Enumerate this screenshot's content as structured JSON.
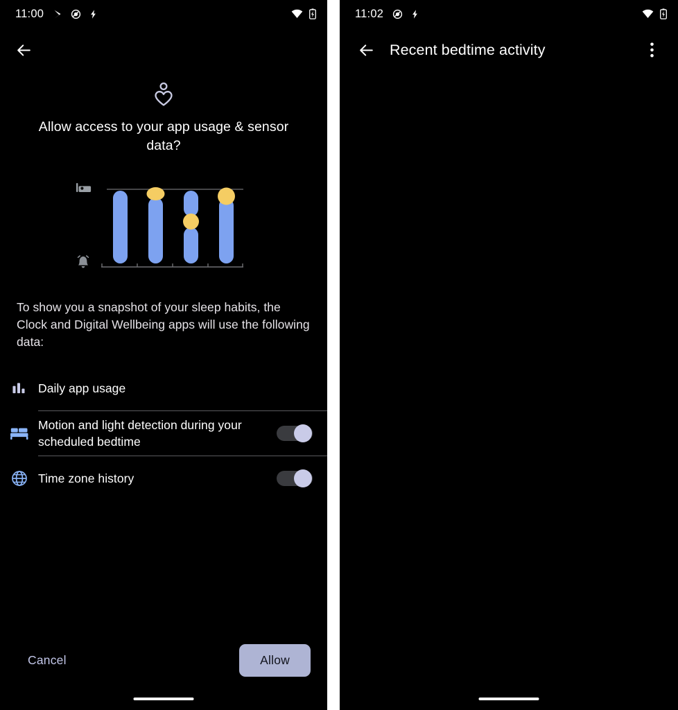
{
  "colors": {
    "background": "#000000",
    "gap": "#ffffff",
    "bar_blue": "#7da2f0",
    "dot_yellow": "#f5cd63",
    "accent_lavender": "#c2c6e8",
    "button_fill": "#aeb4d4",
    "button_text": "#11131c",
    "divider": "#5b5b5f",
    "switch_track": "#3a3b3f",
    "switch_thumb": "#c9cbe8",
    "list_icon_blue": "#8ab4f8",
    "chart_axis": "#6f6f73",
    "illus_icon_gray": "#9aa0a6"
  },
  "left_screen": {
    "status_bar": {
      "time": "11:00",
      "left_icons": [
        "play-store-icon",
        "do-not-disturb-icon",
        "flash-icon"
      ],
      "right_icons": [
        "wifi-icon",
        "battery-charging-icon"
      ]
    },
    "app_bar": {
      "back_icon": "arrow-back-icon"
    },
    "hero_icon": "person-heart-icon",
    "dialog_title": "Allow access to your app usage & sensor data?",
    "illustration": {
      "top_icon": "bed-icon",
      "bottom_icon": "alarm-bell-icon"
    },
    "body_text": "To show you a snapshot of your sleep habits, the Clock and Digital Wellbeing apps will use the following data:",
    "permissions": [
      {
        "icon": "bar-chart-icon",
        "label": "Daily app usage",
        "has_switch": false
      },
      {
        "icon": "bed-icon",
        "label": "Motion and light detection during your scheduled bedtime",
        "has_switch": true,
        "switch_on": true
      },
      {
        "icon": "globe-icon",
        "label": "Time zone history",
        "has_switch": true,
        "switch_on": true
      }
    ],
    "footer": {
      "cancel_label": "Cancel",
      "allow_label": "Allow"
    }
  },
  "right_screen": {
    "status_bar": {
      "time": "11:02",
      "left_icons": [
        "do-not-disturb-icon",
        "flash-icon"
      ],
      "right_icons": [
        "wifi-icon",
        "battery-charging-icon"
      ]
    },
    "app_bar": {
      "back_icon": "arrow-back-icon",
      "title": "Recent bedtime activity",
      "overflow_icon": "more-vert-icon"
    },
    "content": ""
  },
  "chart_data": {
    "type": "bar",
    "title": "",
    "xlabel": "",
    "ylabel": "",
    "categories": [
      "1",
      "2",
      "3",
      "4"
    ],
    "ylim": [
      0,
      100
    ],
    "grid": false,
    "legend": "none",
    "axis_icons": {
      "top": "bed-icon",
      "bottom": "alarm-bell-icon"
    },
    "series": [
      {
        "name": "sleep",
        "color": "#7da2f0",
        "segments": [
          [
            {
              "start": 0,
              "end": 100
            }
          ],
          [
            {
              "start": 0,
              "end": 91
            }
          ],
          [
            {
              "start": 0,
              "end": 51
            },
            {
              "start": 66,
              "end": 100
            }
          ],
          [
            {
              "start": 0,
              "end": 84
            }
          ]
        ]
      },
      {
        "name": "awake-events",
        "color": "#f5cd63",
        "points": [
          {
            "bar": 2,
            "value": 96
          },
          {
            "bar": 3,
            "value": 59
          },
          {
            "bar": 4,
            "value": 90
          }
        ]
      }
    ]
  }
}
